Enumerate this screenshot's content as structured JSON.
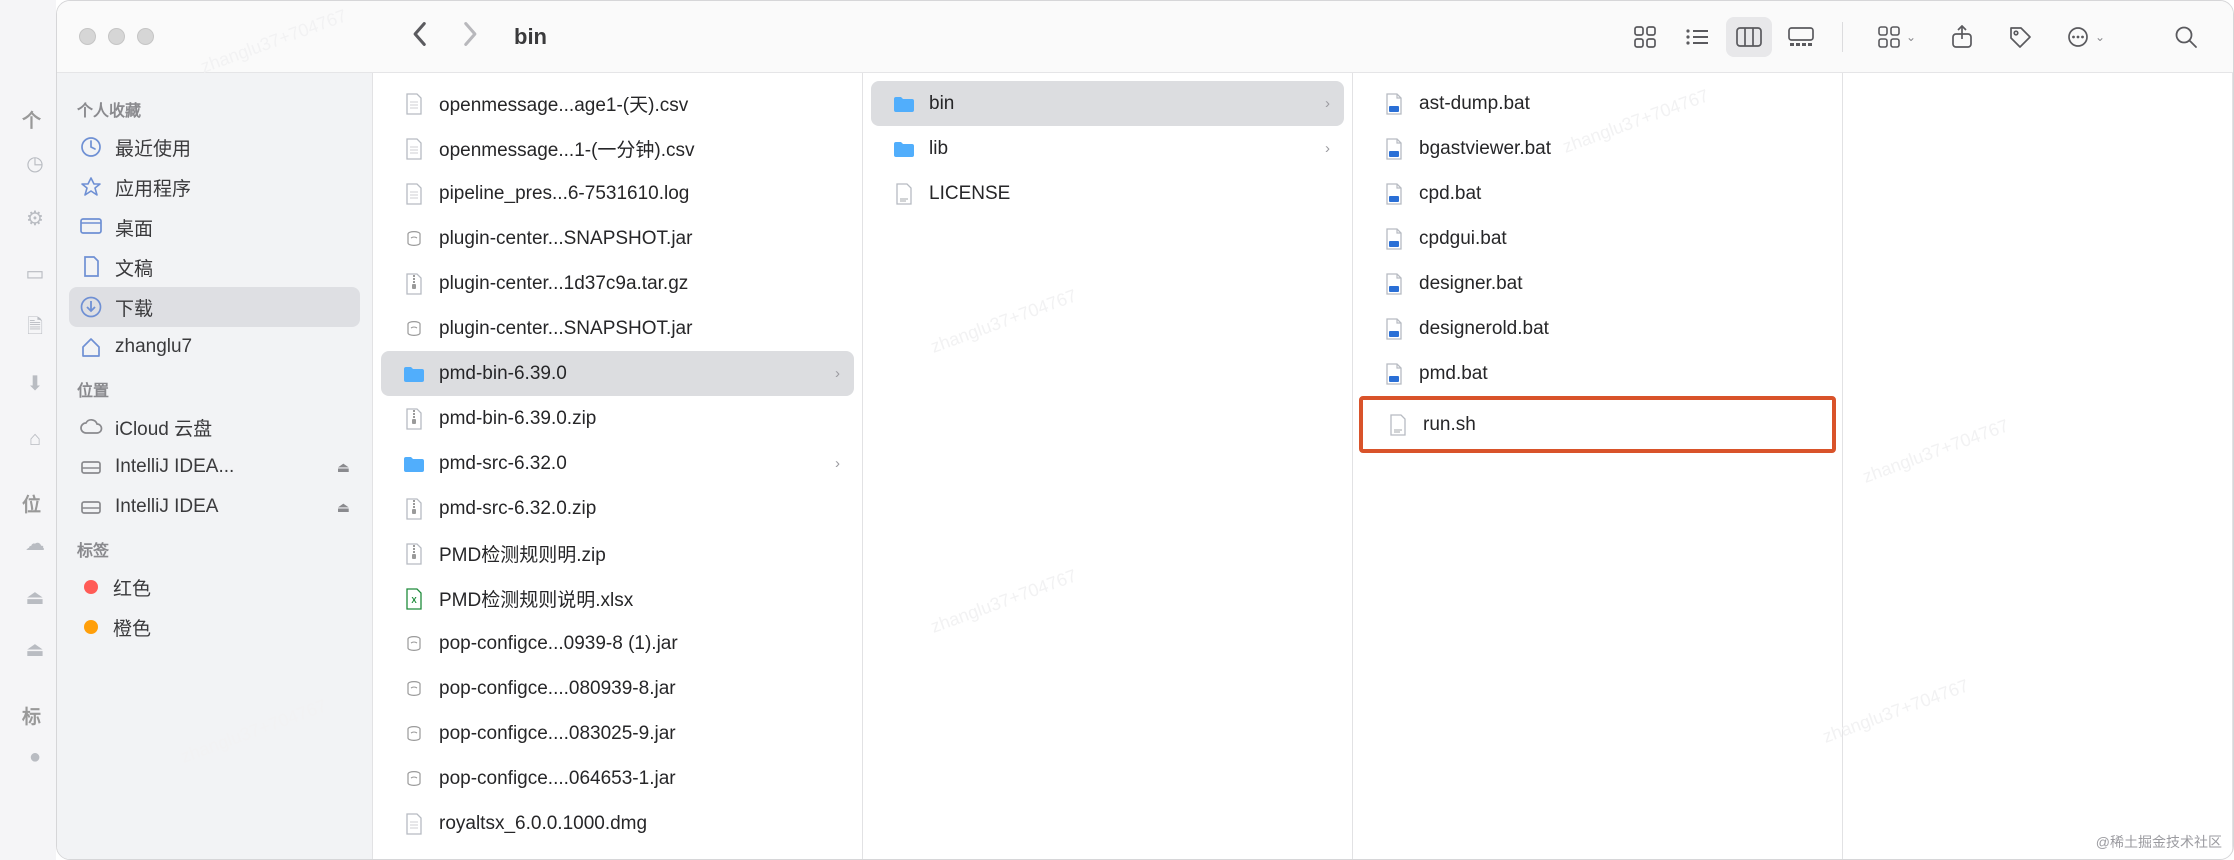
{
  "toolbar": {
    "title": "bin"
  },
  "sidebar": {
    "sections": [
      {
        "header": "个人收藏",
        "items": [
          {
            "icon": "clock",
            "label": "最近使用"
          },
          {
            "icon": "app",
            "label": "应用程序"
          },
          {
            "icon": "desktop",
            "label": "桌面"
          },
          {
            "icon": "doc",
            "label": "文稿"
          },
          {
            "icon": "download",
            "label": "下载",
            "selected": true
          },
          {
            "icon": "home",
            "label": "zhanglu7"
          }
        ]
      },
      {
        "header": "位置",
        "items": [
          {
            "icon": "cloud",
            "label": "iCloud 云盘"
          },
          {
            "icon": "disk",
            "label": "IntelliJ IDEA...",
            "eject": true
          },
          {
            "icon": "disk",
            "label": "IntelliJ IDEA",
            "eject": true
          }
        ]
      },
      {
        "header": "标签",
        "items": [
          {
            "tag": "red",
            "label": "红色"
          },
          {
            "tag": "orange",
            "label": "橙色"
          }
        ]
      }
    ]
  },
  "columns": [
    {
      "items": [
        {
          "icon": "generic",
          "name": "openmessage...age1-(天).csv"
        },
        {
          "icon": "generic",
          "name": "openmessage...1-(一分钟).csv"
        },
        {
          "icon": "generic",
          "name": "pipeline_pres...6-7531610.log"
        },
        {
          "icon": "jar",
          "name": "plugin-center...SNAPSHOT.jar"
        },
        {
          "icon": "zip",
          "name": "plugin-center...1d37c9a.tar.gz"
        },
        {
          "icon": "jar",
          "name": "plugin-center...SNAPSHOT.jar"
        },
        {
          "icon": "folder",
          "name": "pmd-bin-6.39.0",
          "folder": true,
          "selected": true
        },
        {
          "icon": "zip",
          "name": "pmd-bin-6.39.0.zip"
        },
        {
          "icon": "folder",
          "name": "pmd-src-6.32.0",
          "folder": true
        },
        {
          "icon": "zip",
          "name": "pmd-src-6.32.0.zip"
        },
        {
          "icon": "zip",
          "name": "PMD检测规则明.zip"
        },
        {
          "icon": "xls",
          "name": "PMD检测规则说明.xlsx"
        },
        {
          "icon": "jar",
          "name": "pop-configce...0939-8 (1).jar"
        },
        {
          "icon": "jar",
          "name": "pop-configce....080939-8.jar"
        },
        {
          "icon": "jar",
          "name": "pop-configce....083025-9.jar"
        },
        {
          "icon": "jar",
          "name": "pop-configce....064653-1.jar"
        },
        {
          "icon": "generic",
          "name": "royaltsx_6.0.0.1000.dmg"
        }
      ]
    },
    {
      "items": [
        {
          "icon": "folder",
          "name": "bin",
          "folder": true,
          "selected": true
        },
        {
          "icon": "folder",
          "name": "lib",
          "folder": true
        },
        {
          "icon": "txt",
          "name": "LICENSE"
        }
      ]
    },
    {
      "items": [
        {
          "icon": "bat",
          "name": "ast-dump.bat"
        },
        {
          "icon": "bat",
          "name": "bgastviewer.bat"
        },
        {
          "icon": "bat",
          "name": "cpd.bat"
        },
        {
          "icon": "bat",
          "name": "cpdgui.bat"
        },
        {
          "icon": "bat",
          "name": "designer.bat"
        },
        {
          "icon": "bat",
          "name": "designerold.bat"
        },
        {
          "icon": "bat",
          "name": "pmd.bat"
        },
        {
          "icon": "txt",
          "name": "run.sh",
          "highlight": true
        }
      ]
    }
  ],
  "os_strip_labels": {
    "fav": "个",
    "loc": "位",
    "tag": "标"
  },
  "watermark": "@稀土掘金技术社区"
}
